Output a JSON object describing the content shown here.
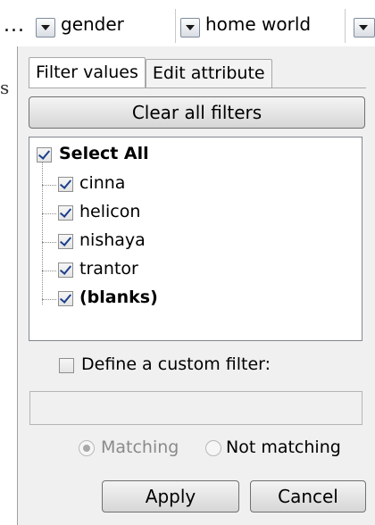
{
  "header": {
    "ellipsis": "...",
    "columns": [
      {
        "label": "gender"
      },
      {
        "label": "home world"
      }
    ],
    "left_partial_text": "s"
  },
  "panel": {
    "tabs": [
      {
        "label": "Filter values",
        "active": true
      },
      {
        "label": "Edit attribute",
        "active": false
      }
    ],
    "clear_button_label": "Clear all filters",
    "select_all": {
      "label": "Select All",
      "checked": true
    },
    "values": [
      {
        "label": "cinna",
        "checked": true,
        "bold": false
      },
      {
        "label": "helicon",
        "checked": true,
        "bold": false
      },
      {
        "label": "nishaya",
        "checked": true,
        "bold": false
      },
      {
        "label": "trantor",
        "checked": true,
        "bold": false
      },
      {
        "label": "(blanks)",
        "checked": true,
        "bold": true
      }
    ],
    "custom_filter": {
      "label": "Define a custom filter:",
      "checked": false,
      "value": ""
    },
    "match_options": [
      {
        "label": "Matching",
        "selected": true
      },
      {
        "label": "Not matching",
        "selected": false
      }
    ],
    "apply_label": "Apply",
    "cancel_label": "Cancel"
  },
  "colors": {
    "panel_bg": "#f0f0f0",
    "checkmark": "#1c3f8c",
    "disabled_text": "#8a8a8a"
  }
}
